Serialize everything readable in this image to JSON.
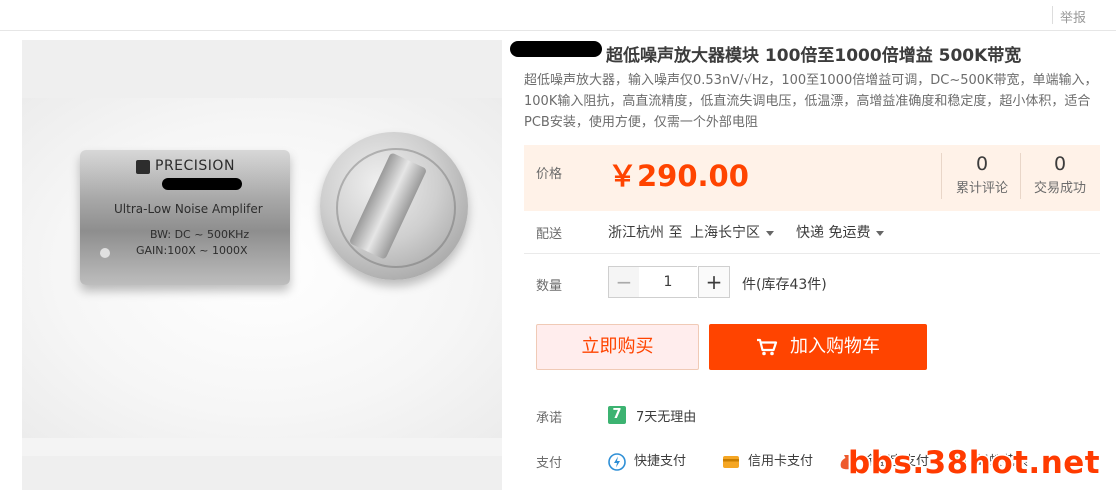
{
  "header": {
    "report_label": "举报"
  },
  "product": {
    "title": "超低噪声放大器模块 100倍至1000倍增益 500K带宽",
    "subtitle": "超低噪声放大器，输入噪声仅0.53nV/√Hz，100至1000倍增益可调，DC~500K带宽，单端输入，100K输入阻抗，高直流精度，低直流失调电压，低温漂，高增益准确度和稳定度，超小体积，适合PCB安装，使用方便，仅需一个外部电阻",
    "image": {
      "module_brand": "PRECISION",
      "module_name": "Ultra-Low Noise Amplifer",
      "module_bw": "BW: DC ~ 500KHz",
      "module_gain": "GAIN:100X ~ 1000X"
    }
  },
  "price": {
    "label": "价格",
    "value": "￥290.00",
    "reviews_count": "0",
    "reviews_label": "累计评论",
    "sales_count": "0",
    "sales_label": "交易成功"
  },
  "shipping": {
    "label": "配送",
    "from": "浙江杭州 至",
    "to": "上海长宁区",
    "method": "快递 免运费"
  },
  "quantity": {
    "label": "数量",
    "minus": "−",
    "value": "1",
    "plus": "+",
    "stock": "件(库存43件)"
  },
  "actions": {
    "buy_now": "立即购买",
    "add_to_cart": "加入购物车"
  },
  "promise": {
    "label": "承诺",
    "icon_text": "7",
    "text": "7天无理由"
  },
  "payment": {
    "label": "支付",
    "methods": [
      "快捷支付",
      "信用卡支付",
      "余额宝支付",
      "蚂蚁花呗"
    ]
  },
  "watermark": "bbs.38hot.net",
  "colors": {
    "accent": "#ff4400",
    "price_bg": "#fff2e8",
    "buy_bg": "#ffeded",
    "promise_green": "#3cb371"
  },
  "icons": {
    "cart": "shopping-cart-icon",
    "quick_pay": "quick-pay-icon",
    "credit_card": "credit-card-icon",
    "yuebao": "money-bag-icon",
    "huabei": "huabei-icon"
  }
}
